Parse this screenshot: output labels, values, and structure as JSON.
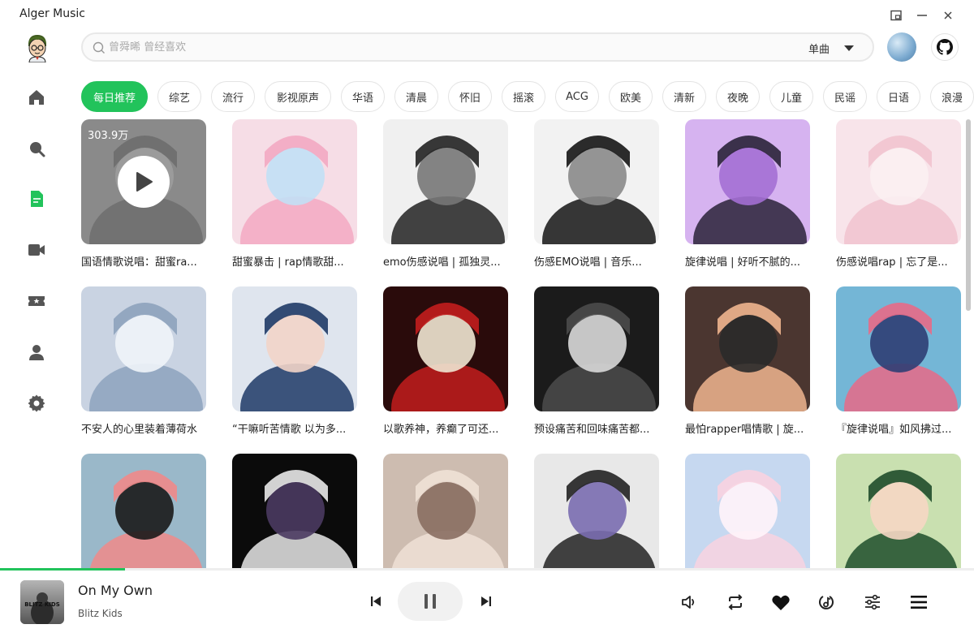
{
  "app": {
    "title": "Alger Music"
  },
  "search": {
    "placeholder": "曾舜晞 曾经喜欢",
    "type_label": "单曲"
  },
  "categories": [
    "每日推荐",
    "综艺",
    "流行",
    "影视原声",
    "华语",
    "清晨",
    "怀旧",
    "摇滚",
    "ACG",
    "欧美",
    "清新",
    "夜晚",
    "儿童",
    "民谣",
    "日语",
    "浪漫"
  ],
  "playlists": [
    {
      "title": "国语情歌说唱：甜蜜ra...",
      "play_count": "303.9万"
    },
    {
      "title": "甜蜜暴击 | rap情歌甜..."
    },
    {
      "title": "emo伤感说唱 | 孤独灵..."
    },
    {
      "title": "伤感EMO说唱 | 音乐..."
    },
    {
      "title": "旋律说唱 | 好听不腻的..."
    },
    {
      "title": "伤感说唱rap | 忘了是..."
    },
    {
      "title": "不安人的心里装着薄荷水"
    },
    {
      "title": "“干嘛听苦情歌 以为多..."
    },
    {
      "title": "以歌养神，养癫了可还..."
    },
    {
      "title": "预设痛苦和回味痛苦都..."
    },
    {
      "title": "最怕rapper唱情歌 | 旋..."
    },
    {
      "title": "『旋律说唱』如风拂过..."
    },
    {
      "title": ""
    },
    {
      "title": ""
    },
    {
      "title": ""
    },
    {
      "title": ""
    },
    {
      "title": ""
    },
    {
      "title": ""
    }
  ],
  "player": {
    "song_title": "On My Own",
    "artist": "Blitz Kids",
    "progress": 0.128,
    "cover_text": "BLITZ KIDS"
  },
  "icons": {
    "nav": [
      "home-icon",
      "search-icon",
      "playlist-icon",
      "video-icon",
      "ticket-icon",
      "user-icon",
      "settings-icon"
    ]
  },
  "colors": {
    "accent": "#22c35b",
    "active_nav": "#22c35b",
    "nav": "#555555"
  }
}
